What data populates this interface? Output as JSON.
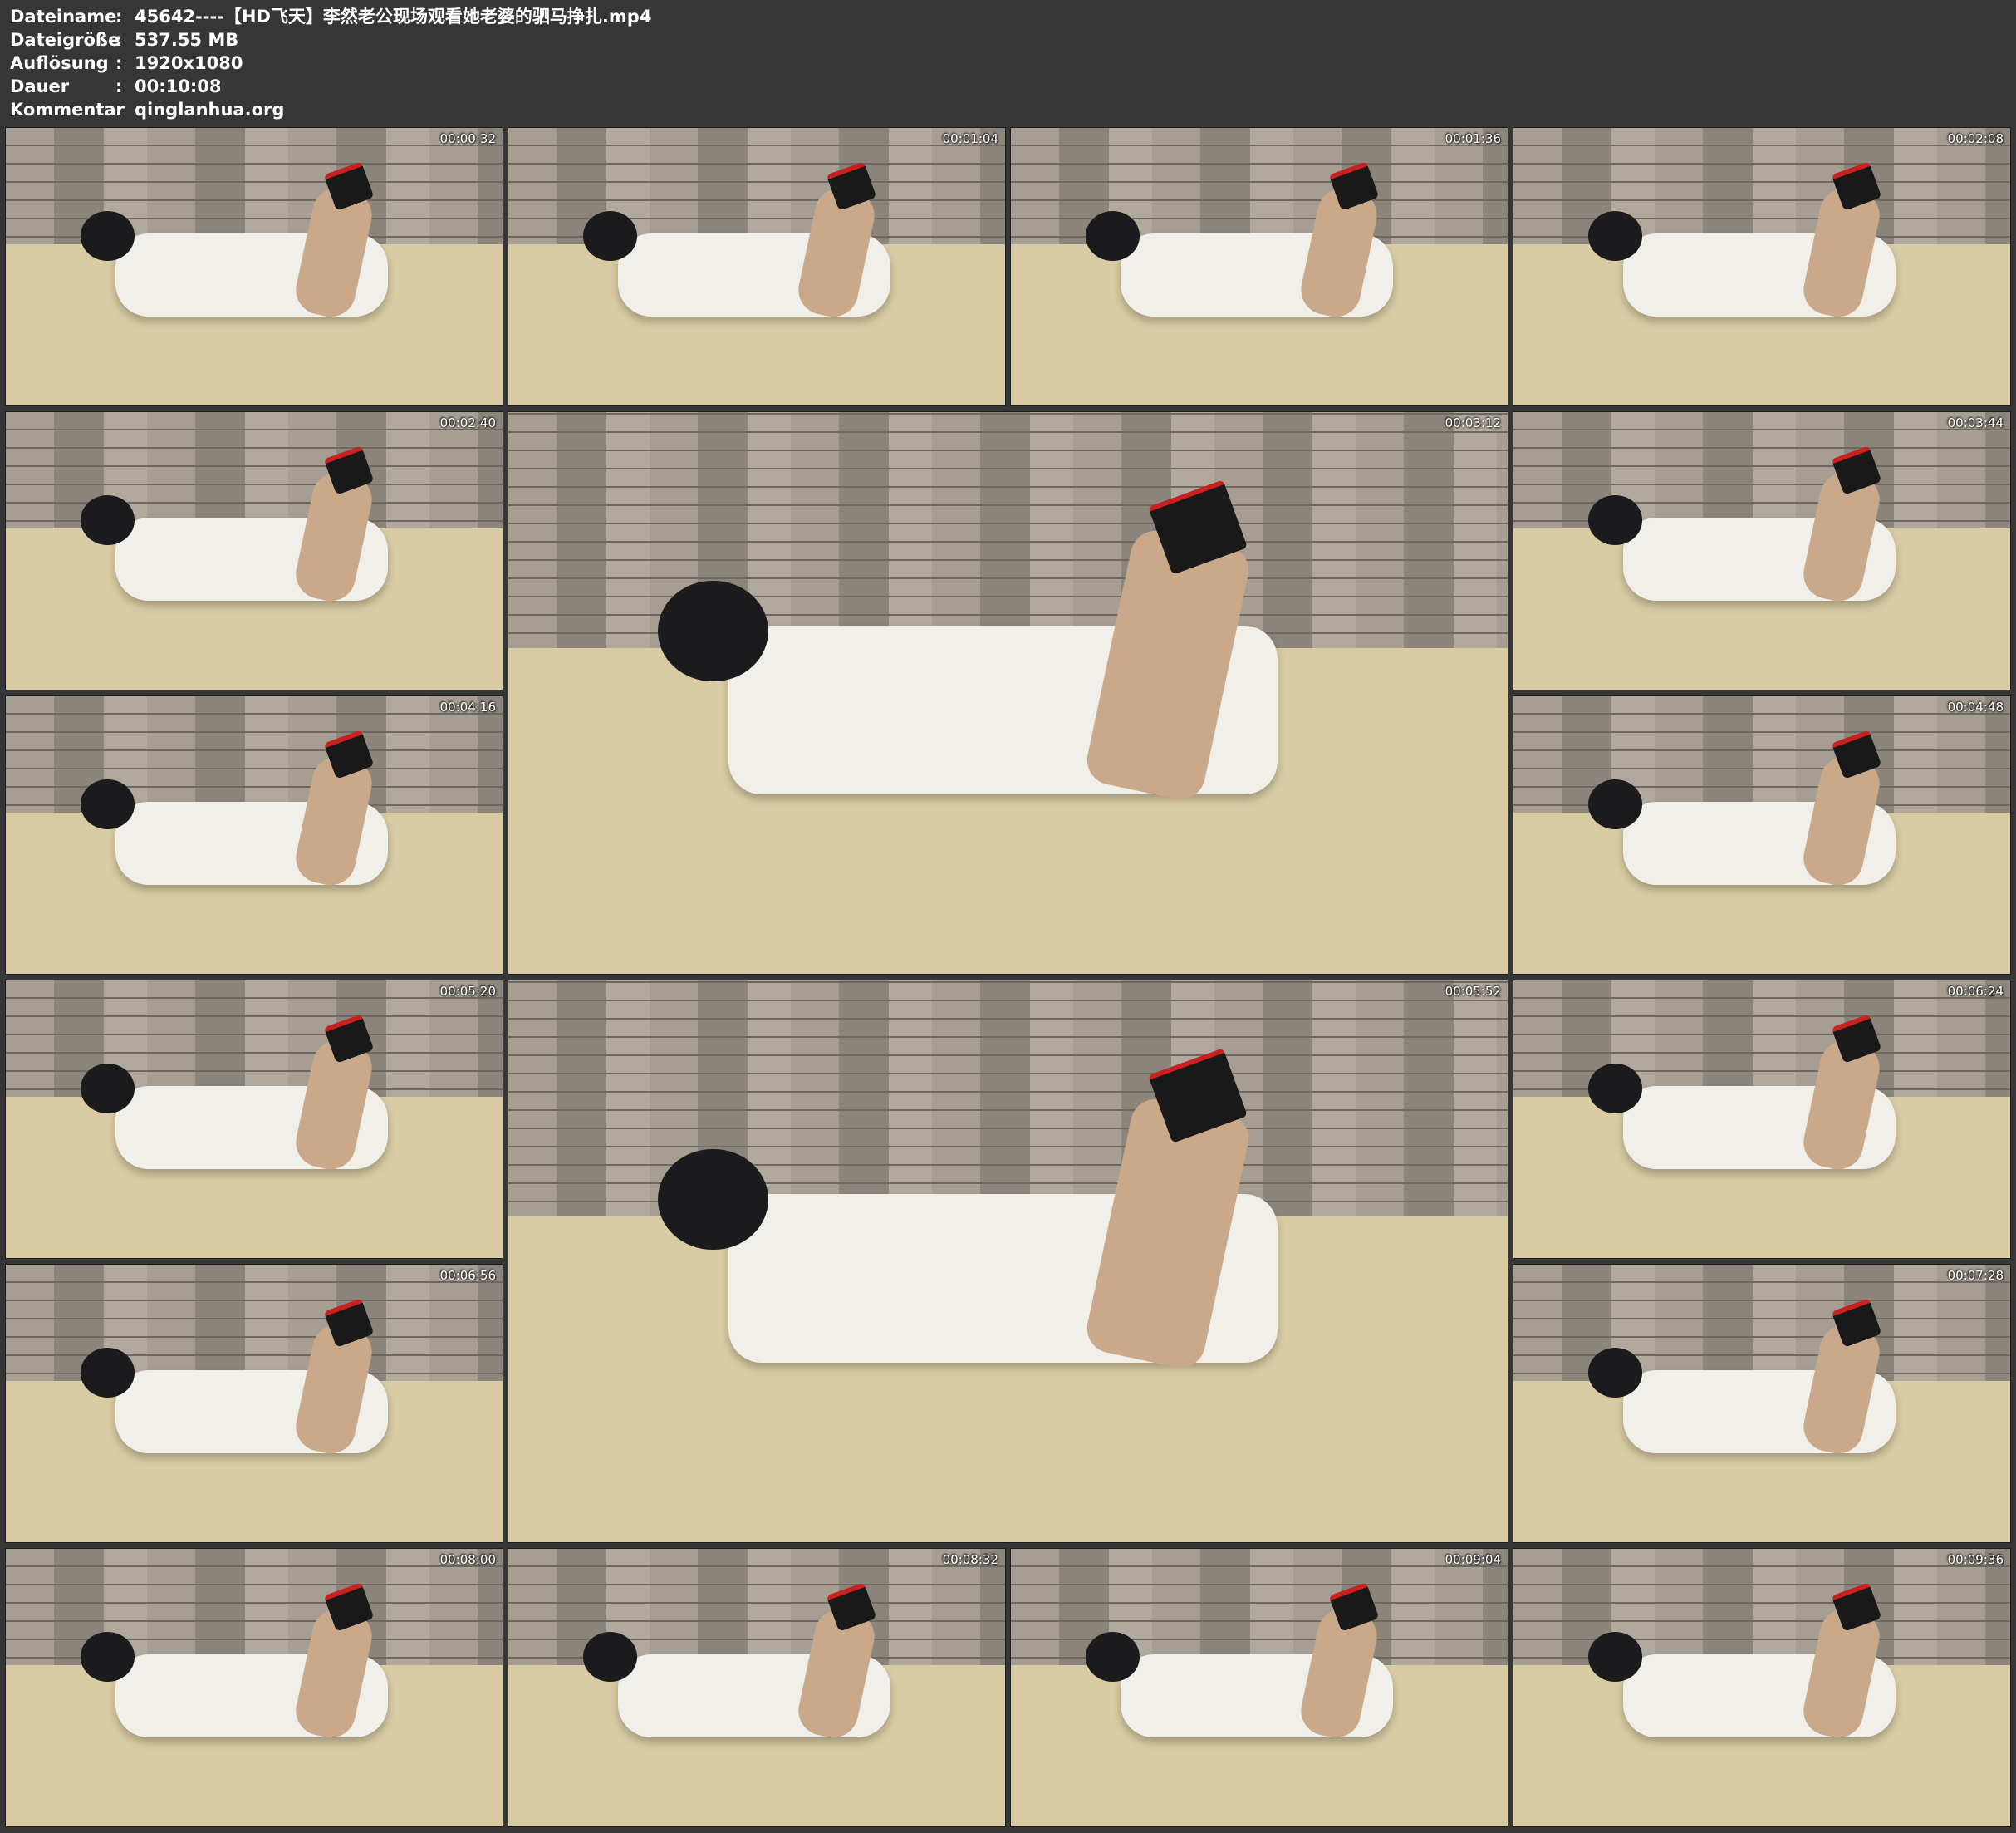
{
  "meta": {
    "rows": [
      {
        "key": "Dateiname",
        "value": "45642----【HD飞天】李然老公现场观看她老婆的驷马挣扎.mp4"
      },
      {
        "key": "Dateigröße",
        "value": "537.55 MB"
      },
      {
        "key": "Auflösung",
        "value": "1920x1080"
      },
      {
        "key": "Dauer",
        "value": "00:10:08"
      },
      {
        "key": "Kommentar",
        "value": "qinglanhua.org"
      }
    ],
    "separator": ":"
  },
  "thumbnails": [
    {
      "time": "00:00:32"
    },
    {
      "time": "00:01:04"
    },
    {
      "time": "00:01:36"
    },
    {
      "time": "00:02:08"
    },
    {
      "time": "00:02:40"
    },
    {
      "time": "00:03:12"
    },
    {
      "time": "00:03:44"
    },
    {
      "time": "00:04:16"
    },
    {
      "time": "00:04:48"
    },
    {
      "time": "00:05:20"
    },
    {
      "time": "00:05:52"
    },
    {
      "time": "00:06:24"
    },
    {
      "time": "00:06:56"
    },
    {
      "time": "00:07:28"
    },
    {
      "time": "00:08:00"
    },
    {
      "time": "00:08:32"
    },
    {
      "time": "00:09:04"
    },
    {
      "time": "00:09:36"
    }
  ]
}
